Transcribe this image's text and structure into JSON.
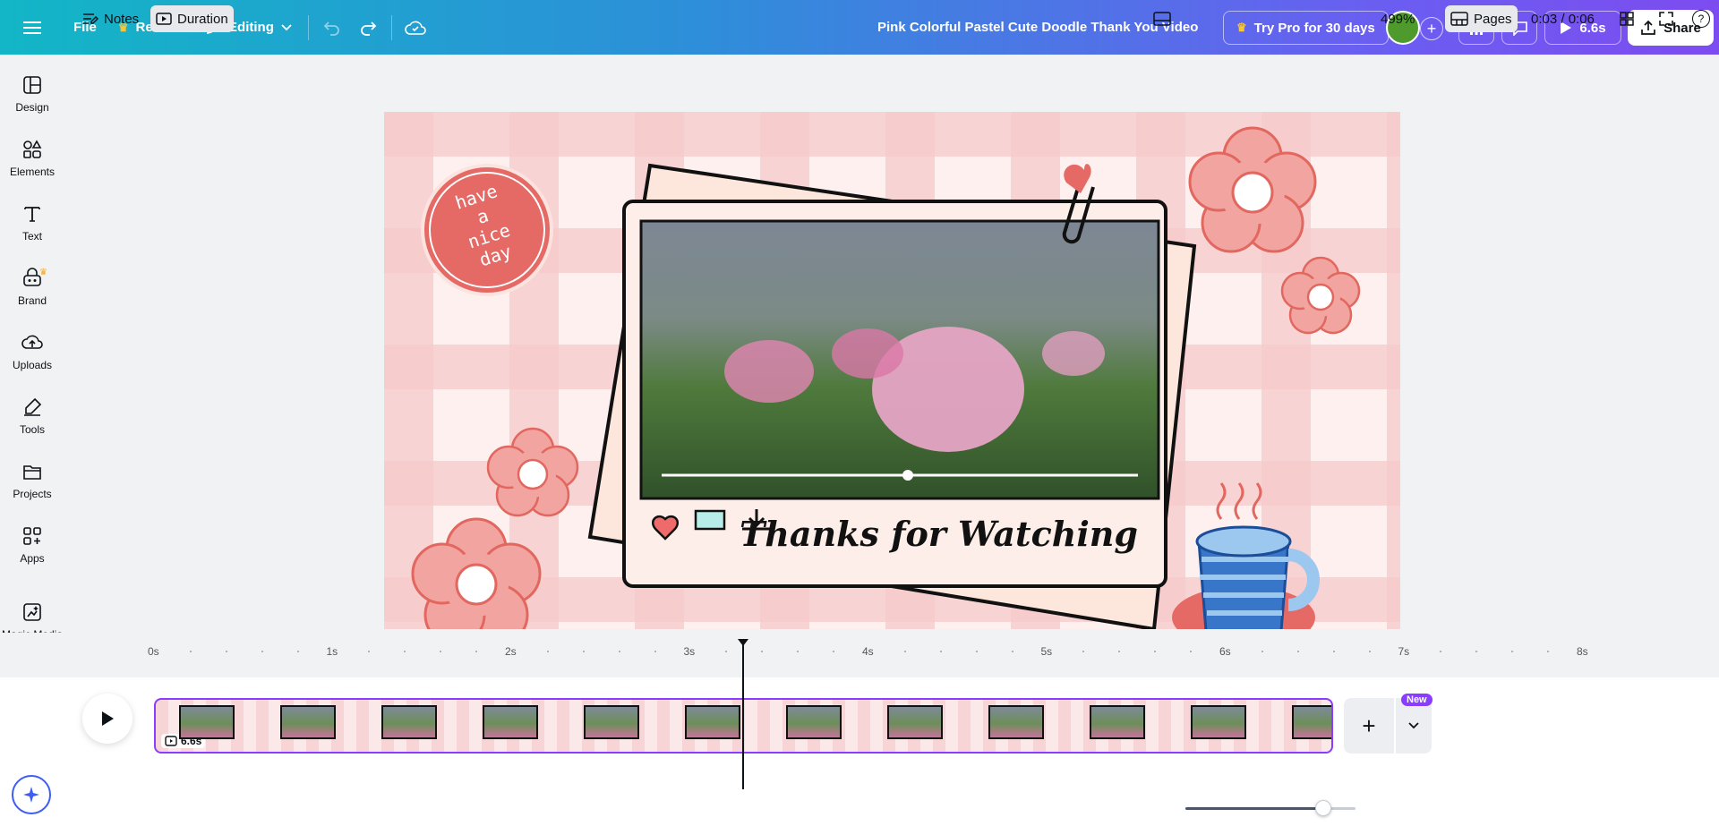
{
  "topbar": {
    "menu_icon": "hamburger-icon",
    "file_label": "File",
    "resize_label": "Resize",
    "editing_label": "Editing",
    "doc_title": "Pink Colorful Pastel Cute Doodle Thank You Video",
    "try_pro_label": "Try Pro for 30 days",
    "play_duration": "6.6s",
    "share_label": "Share"
  },
  "sidebar": {
    "items": [
      {
        "label": "Design",
        "icon": "design-icon"
      },
      {
        "label": "Elements",
        "icon": "elements-icon"
      },
      {
        "label": "Text",
        "icon": "text-icon"
      },
      {
        "label": "Brand",
        "icon": "brand-icon"
      },
      {
        "label": "Uploads",
        "icon": "uploads-icon"
      },
      {
        "label": "Tools",
        "icon": "tools-icon"
      },
      {
        "label": "Projects",
        "icon": "projects-icon"
      },
      {
        "label": "Apps",
        "icon": "apps-icon"
      },
      {
        "label": "Magic Media",
        "icon": "magic-media-icon"
      }
    ]
  },
  "canvas": {
    "badge_text": [
      "have",
      "a",
      "nice",
      "day"
    ],
    "caption": "Thanks for Watching",
    "video_progress": 0.52
  },
  "timeline": {
    "ticks": [
      "0s",
      "1s",
      "2s",
      "3s",
      "4s",
      "5s",
      "6s",
      "7s",
      "8s"
    ],
    "clip_duration": "6.6s",
    "new_badge": "New",
    "playhead_seconds": 3.3
  },
  "bottombar": {
    "notes_label": "Notes",
    "duration_label": "Duration",
    "zoom_level": "499%",
    "zoom_fraction": 0.81,
    "pages_label": "Pages",
    "time_readout": "0:03 / 0:06",
    "help_label": "?"
  },
  "colors": {
    "accent_purple": "#8b3dff",
    "brand_gradient_start": "#12b6c6",
    "brand_gradient_end": "#7d4cf0",
    "canvas_pink": "#f3b7b8",
    "badge_red": "#e56a66"
  }
}
